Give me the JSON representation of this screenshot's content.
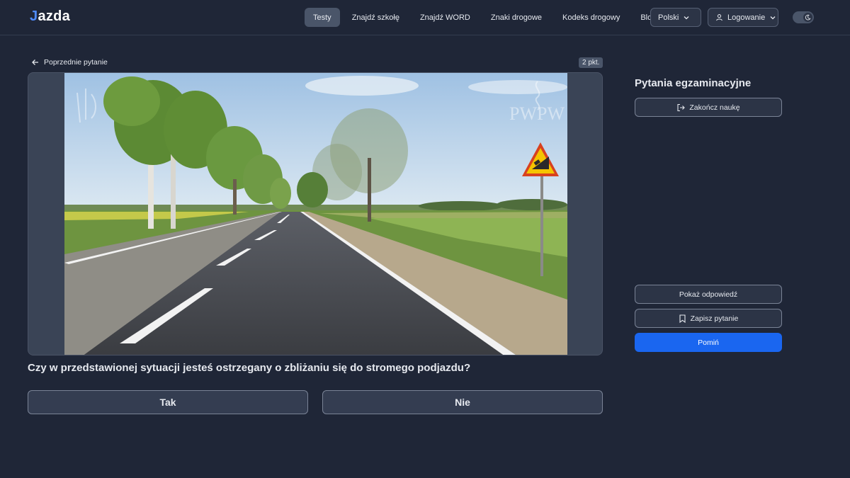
{
  "header": {
    "logo": {
      "first": "J",
      "rest": "azda"
    },
    "nav": [
      {
        "label": "Testy",
        "active": true
      },
      {
        "label": "Znajdź szkołę",
        "active": false
      },
      {
        "label": "Znajdź WORD",
        "active": false
      },
      {
        "label": "Znaki drogowe",
        "active": false
      },
      {
        "label": "Kodeks drogowy",
        "active": false
      },
      {
        "label": "Blog",
        "active": false
      }
    ],
    "language": {
      "selected": "Polski",
      "icon": "chevron-down-icon"
    },
    "login": {
      "label": "Logowanie",
      "icon": "user-icon"
    },
    "theme_toggle": {
      "icon": "moon-icon"
    }
  },
  "question": {
    "back_label": "Poprzednie pytanie",
    "points": "2 pkt.",
    "image_watermark": "PWPW",
    "text": "Czy w przedstawionej sytuacji jesteś ostrzegany o zbliżaniu się do stromego podjazdu?",
    "answers": [
      {
        "label": "Tak"
      },
      {
        "label": "Nie"
      }
    ]
  },
  "sidebar": {
    "title": "Pytania egzaminacyjne",
    "finish_label": "Zakończ naukę",
    "show_answer_label": "Pokaż odpowiedź",
    "save_question_label": "Zapisz pytanie",
    "skip_label": "Pomiń"
  },
  "colors": {
    "background": "#1f2637",
    "primary": "#1a66f0",
    "accent": "#4f8cff",
    "sign_yellow": "#f5c400",
    "sign_border": "#d8411f"
  }
}
